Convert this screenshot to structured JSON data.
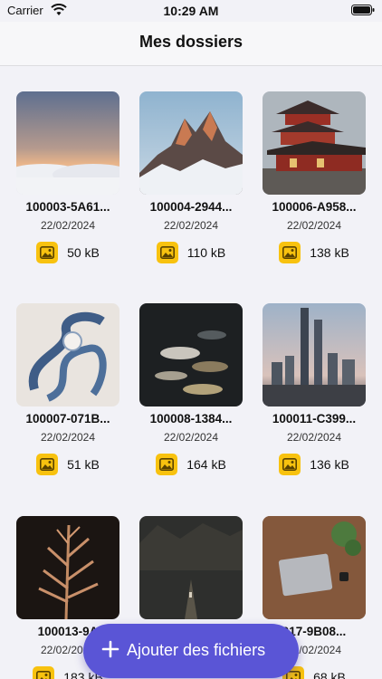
{
  "status_bar": {
    "carrier": "Carrier",
    "time": "10:29 AM"
  },
  "header": {
    "title": "Mes dossiers"
  },
  "files": [
    {
      "name": "100003-5A61...",
      "date": "22/02/2024",
      "size": "50 kB",
      "thumb": "sky-clouds"
    },
    {
      "name": "100004-2944...",
      "date": "22/02/2024",
      "size": "110 kB",
      "thumb": "mountain"
    },
    {
      "name": "100006-A958...",
      "date": "22/02/2024",
      "size": "138 kB",
      "thumb": "pagoda"
    },
    {
      "name": "100007-071B...",
      "date": "22/02/2024",
      "size": "51 kB",
      "thumb": "sculpture"
    },
    {
      "name": "100008-1384...",
      "date": "22/02/2024",
      "size": "164 kB",
      "thumb": "koi-fish"
    },
    {
      "name": "100011-C399...",
      "date": "22/02/2024",
      "size": "136 kB",
      "thumb": "skyline"
    },
    {
      "name": "100013-9A",
      "date": "22/02/2024",
      "size": "183 kB",
      "thumb": "plant"
    },
    {
      "name": "",
      "date": "",
      "size": "",
      "thumb": "forest-path"
    },
    {
      "name": "017-9B08...",
      "date": "22/02/2024",
      "size": "68 kB",
      "thumb": "laptop-desk"
    }
  ],
  "fab": {
    "label": "Ajouter des fichiers"
  },
  "colors": {
    "accent": "#5a55d6",
    "file_icon": "#f8c20f",
    "background": "#f2f2f7"
  }
}
